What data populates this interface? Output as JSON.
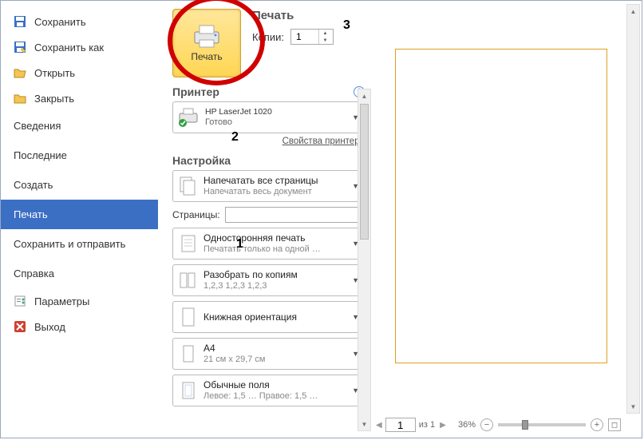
{
  "sidebar": {
    "items": [
      {
        "label": "Сохранить"
      },
      {
        "label": "Сохранить как"
      },
      {
        "label": "Открыть"
      },
      {
        "label": "Закрыть"
      },
      {
        "label": "Сведения"
      },
      {
        "label": "Последние"
      },
      {
        "label": "Создать"
      },
      {
        "label": "Печать"
      },
      {
        "label": "Сохранить и отправить"
      },
      {
        "label": "Справка"
      },
      {
        "label": "Параметры"
      },
      {
        "label": "Выход"
      }
    ]
  },
  "print": {
    "title": "Печать",
    "button_label": "Печать",
    "copies_label": "Копии:",
    "copies_value": "1"
  },
  "printer": {
    "heading": "Принтер",
    "name": "HP LaserJet 1020",
    "status": "Готово",
    "props_link": "Свойства принтера"
  },
  "settings": {
    "heading": "Настройка",
    "pages_label": "Страницы:",
    "pages_value": "",
    "options": [
      {
        "title": "Напечатать все страницы",
        "sub": "Напечатать весь документ"
      },
      {
        "title": "Односторонняя печать",
        "sub": "Печатать только на одной …"
      },
      {
        "title": "Разобрать по копиям",
        "sub": "1,2,3   1,2,3   1,2,3"
      },
      {
        "title": "Книжная ориентация",
        "sub": ""
      },
      {
        "title": "A4",
        "sub": "21 см x 29,7 см"
      },
      {
        "title": "Обычные поля",
        "sub": "Левое: 1,5 …  Правое: 1,5 …"
      }
    ]
  },
  "preview": {
    "page_nav": {
      "current": "1",
      "total_label": "из 1"
    },
    "zoom_label": "36%"
  },
  "annotations": {
    "a1": "1",
    "a2": "2",
    "a3": "3"
  }
}
